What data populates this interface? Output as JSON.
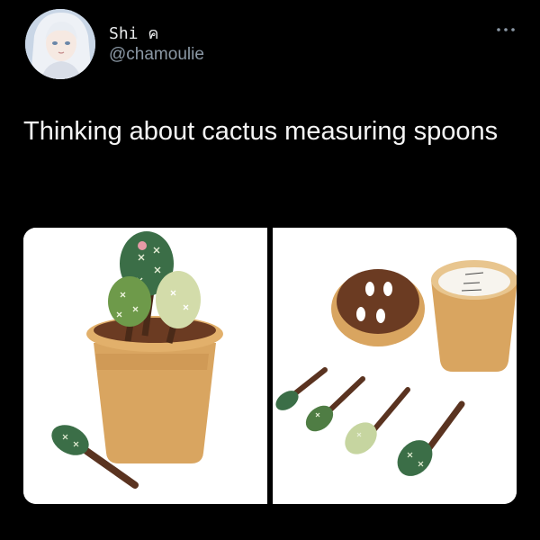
{
  "tweet": {
    "display_name": "Shi",
    "name_glyph": "ค",
    "handle": "@chamoulie",
    "text": "Thinking about cactus measuring spoons",
    "more_icon": "ellipsis-icon",
    "media": [
      {
        "description_icon": "cactus-spoon-pot-photo"
      },
      {
        "description_icon": "cactus-spoon-set-photo"
      }
    ]
  },
  "colors": {
    "background": "#000000",
    "primary_text": "#e7e9ea",
    "secondary_text": "#8b98a5",
    "pot_terracotta": "#d9a560",
    "cactus_dark_green": "#3b6e47",
    "cactus_light_green": "#c6d5a0"
  }
}
